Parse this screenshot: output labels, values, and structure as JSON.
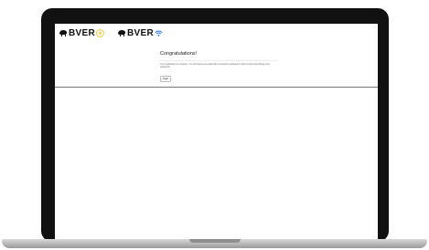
{
  "header": {
    "logo_left": {
      "text": "BVER",
      "sub": "HIGH SPEED INTERNET SERVICE",
      "icon": "lightning-bolt-icon"
    },
    "logo_right": {
      "text": "BVER",
      "sub": "HIGH SPEED INTERNET SERVICE",
      "icon": "wifi-icon"
    }
  },
  "card": {
    "title": "Congratulations!",
    "message": "Your registration is complete. You will receive an email with a temporary password. Click to login and change your password.",
    "login_label": "Login"
  },
  "colors": {
    "bolt_yellow": "#f2c21b",
    "wifi_blue": "#1d6fe0",
    "bezel": "#111111"
  }
}
